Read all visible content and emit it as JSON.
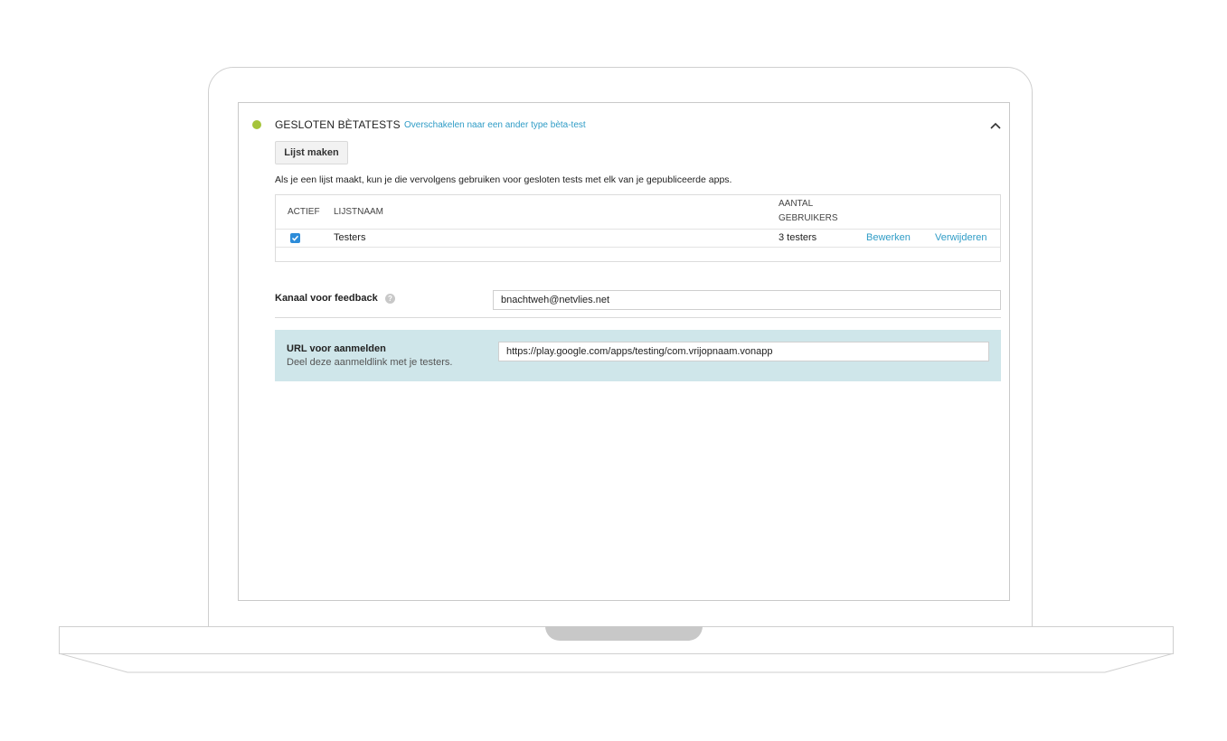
{
  "section": {
    "title": "GESLOTEN BÈTATESTS",
    "switch_link": "Overschakelen naar een ander type bèta-test",
    "status_color": "#a5c43a",
    "collapse_icon": "chevron-up-icon"
  },
  "create_list_button": "Lijst maken",
  "description": "Als je een lijst maakt, kun je die vervolgens gebruiken voor gesloten tests met elk van je gepubliceerde apps.",
  "table": {
    "headers": {
      "active": "ACTIEF",
      "list_name": "LIJSTNAAM",
      "user_count_line1": "AANTAL",
      "user_count_line2": "GEBRUIKERS"
    },
    "rows": [
      {
        "active": true,
        "name": "Testers",
        "count": "3 testers",
        "edit": "Bewerken",
        "delete": "Verwijderen"
      }
    ]
  },
  "feedback": {
    "label": "Kanaal voor feedback",
    "value": "bnachtweh@netvlies.net",
    "help_icon": "question-mark-icon"
  },
  "optin": {
    "label": "URL voor aanmelden",
    "sublabel": "Deel deze aanmeldlink met je testers.",
    "value": "https://play.google.com/apps/testing/com.vrijopnaam.vonapp"
  },
  "colors": {
    "link": "#2f9cc6",
    "panel": "#cfe6ea",
    "checkbox": "#2d8cd9"
  }
}
